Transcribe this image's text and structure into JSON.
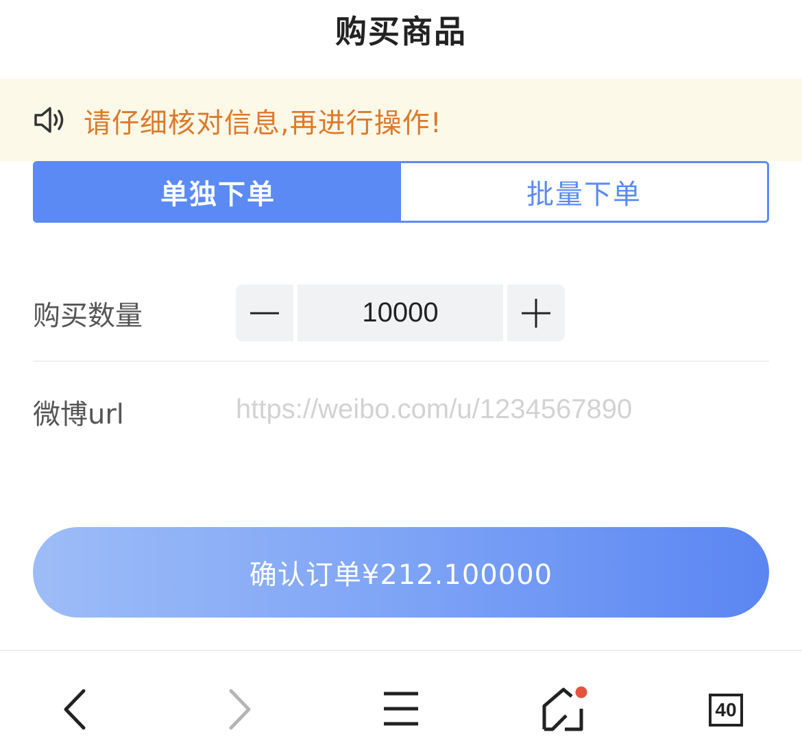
{
  "header": {
    "title": "购买商品"
  },
  "notice": {
    "icon": "speaker-icon",
    "text": "请仔细核对信息,再进行操作!",
    "color": "#dc7a2a",
    "background": "#fdf9e8"
  },
  "tabs": [
    {
      "label": "单独下单",
      "active": true
    },
    {
      "label": "批量下单",
      "active": false
    }
  ],
  "form": {
    "quantity": {
      "label": "购买数量",
      "value": "10000"
    },
    "weibo": {
      "label": "微博url",
      "placeholder": "https://weibo.com/u/1234567890"
    }
  },
  "confirm": {
    "label": "确认订单¥212.100000"
  },
  "bottom_nav": {
    "tab_count": "40",
    "icons": [
      "back-icon",
      "forward-icon",
      "menu-icon",
      "home-icon",
      "tabs-icon"
    ]
  },
  "colors": {
    "accent": "#5b8af5",
    "notification_dot": "#e5533f"
  }
}
